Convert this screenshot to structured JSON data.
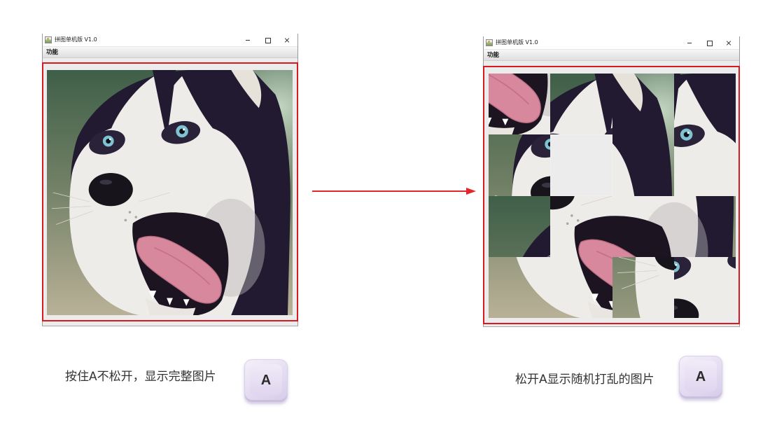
{
  "windows": {
    "complete": {
      "title": "拼图单机版 V1.0",
      "title_icon": "app-icon",
      "controls": [
        "minimize-icon",
        "maximize-icon",
        "close-icon"
      ],
      "menu": {
        "function_label": "功能"
      }
    },
    "shuffled": {
      "title": "拼图单机版 V1.0",
      "title_icon": "app-icon",
      "controls": [
        "minimize-icon",
        "maximize-icon",
        "close-icon"
      ],
      "menu": {
        "function_label": "功能"
      }
    }
  },
  "puzzle": {
    "rows": 4,
    "columns": 4,
    "image_subject_icon": "husky-photo"
  },
  "annotation": {
    "arrow_icon": "arrow-right-icon",
    "highlight_color": "#d71920",
    "arrow_color": "#e3262b"
  },
  "captions": {
    "complete": "按住A不松开，显示完整图片",
    "shuffled": "松开A显示随机打乱的图片"
  },
  "keys": {
    "complete": "A",
    "shuffled": "A"
  }
}
